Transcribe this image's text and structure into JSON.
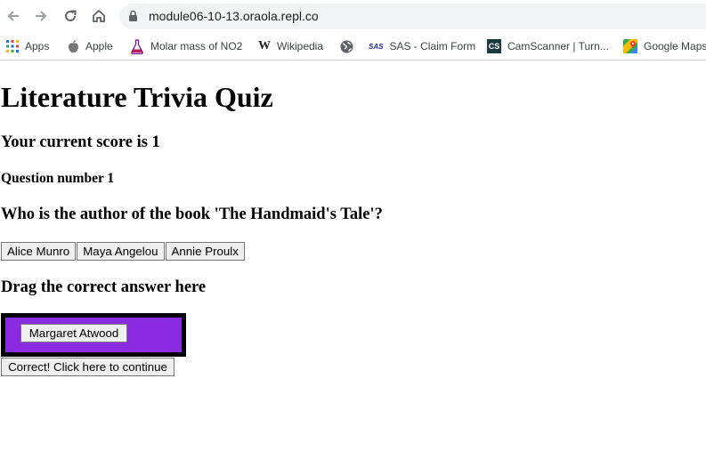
{
  "browser": {
    "url": "module06-10-13.oraola.repl.co",
    "bookmarks": [
      {
        "label": "Apps",
        "icon": "apps-grid-icon"
      },
      {
        "label": "Apple",
        "icon": "apple-icon"
      },
      {
        "label": "Molar mass of NO2",
        "icon": "flask-icon"
      },
      {
        "label": "Wikipedia",
        "icon": "wikipedia-icon"
      },
      {
        "label": "",
        "icon": "globe-icon"
      },
      {
        "label": "SAS - Claim Form",
        "icon": "sas-icon",
        "icon_text": "SAS"
      },
      {
        "label": "CamScanner | Turn...",
        "icon": "camscanner-icon",
        "icon_text": "CS"
      },
      {
        "label": "Google Maps",
        "icon": "google-maps-icon"
      }
    ]
  },
  "page": {
    "title": "Literature Trivia Quiz",
    "score_text": "Your current score is 1",
    "question_number_text": "Question number 1",
    "question_text": "Who is the author of the book 'The Handmaid's Tale'?",
    "options": [
      "Alice Munro",
      "Maya Angelou",
      "Annie Proulx"
    ],
    "drag_label": "Drag the correct answer here",
    "dropped_answer": "Margaret Atwood",
    "continue_label": "Correct! Click here to continue"
  },
  "colors": {
    "dropzone_fill": "#8a2be2",
    "dropzone_border": "#000000"
  }
}
